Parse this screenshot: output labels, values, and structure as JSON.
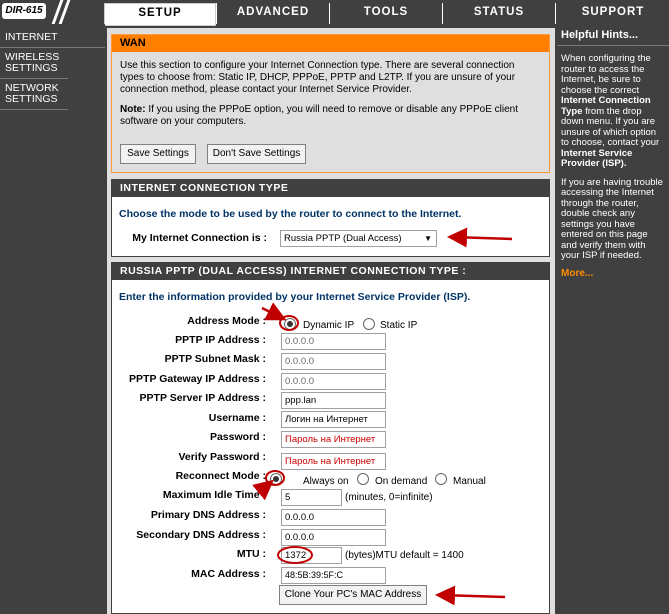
{
  "brand": {
    "model": "DIR-615"
  },
  "tabs": [
    "SETUP",
    "ADVANCED",
    "TOOLS",
    "STATUS",
    "SUPPORT"
  ],
  "sidebar": {
    "items": [
      "INTERNET",
      "WIRELESS SETTINGS",
      "NETWORK SETTINGS"
    ]
  },
  "wan": {
    "title": "WAN",
    "desc": "Use this section to configure your Internet Connection type. There are several connection types to choose from: Static IP, DHCP, PPPoE, PPTP and L2TP. If you are unsure of your connection method, please contact your Internet Service Provider.",
    "note_label": "Note:",
    "note": "If you using the PPPoE option, you will need to remove or disable any PPPoE client software on your computers.",
    "save_label": "Save Settings",
    "dont_save_label": "Don't Save Settings"
  },
  "conn_type": {
    "title": "INTERNET CONNECTION TYPE",
    "instruction": "Choose the mode to be used by the router to connect to the Internet.",
    "label": "My Internet Connection is :",
    "selected": "Russia PPTP (Dual Access)"
  },
  "pptp": {
    "title": "RUSSIA PPTP (DUAL ACCESS) INTERNET CONNECTION TYPE :",
    "instruction": "Enter the information provided by your Internet Service Provider (ISP).",
    "address_mode_label": "Address Mode :",
    "dynamic_ip": "Dynamic IP",
    "static_ip": "Static IP",
    "ip_label": "PPTP IP Address :",
    "ip_value": "0.0.0.0",
    "mask_label": "PPTP Subnet Mask :",
    "mask_value": "0.0.0.0",
    "gw_label": "PPTP Gateway IP Address :",
    "gw_value": "0.0.0.0",
    "server_label": "PPTP Server IP Address :",
    "server_value": "ppp.lan",
    "user_label": "Username :",
    "user_value": "Логин на Интернет",
    "pass_label": "Password :",
    "pass_value": "Пароль на Интернет",
    "vpass_label": "Verify Password :",
    "vpass_value": "Пароль на Интернет",
    "reconnect_label": "Reconnect Mode :",
    "always_on": "Always on",
    "on_demand": "On demand",
    "manual": "Manual",
    "idle_label": "Maximum Idle Time :",
    "idle_value": "5",
    "idle_hint": "(minutes, 0=infinite)",
    "dns1_label": "Primary DNS Address :",
    "dns1_value": "0.0.0.0",
    "dns2_label": "Secondary DNS Address :",
    "dns2_value": "0.0.0.0",
    "mtu_label": "MTU :",
    "mtu_value": "1372",
    "mtu_hint": "(bytes)MTU default = 1400",
    "mac_label": "MAC Address :",
    "mac_value": "48:5B:39:5F:C",
    "clone_label": "Clone Your PC's MAC Address"
  },
  "help": {
    "title": "Helpful Hints...",
    "p1_a": "When configuring the router to access the Internet, be sure to choose the correct",
    "p1_b": "Internet Connection Type",
    "p1_c": "from the drop down menu. If you are unsure of which option to choose, contact your",
    "p1_d": "Internet Service Provider (ISP).",
    "p2": "If you are having trouble accessing the Internet through the router, double check any settings you have entered on this page and verify them with your ISP if needed.",
    "more": "More..."
  },
  "colors": {
    "accent": "#ff7f00",
    "dark": "#404040",
    "annotation": "#c00000"
  }
}
